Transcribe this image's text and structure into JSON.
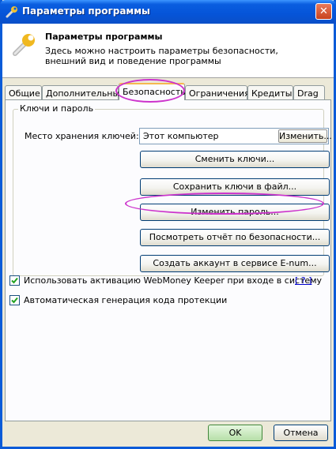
{
  "window": {
    "title": "Параметры программы",
    "close_glyph": "✕"
  },
  "header": {
    "title": "Параметры программы",
    "description": "Здесь можно настроить параметры безопасности, внешний вид и поведение программы"
  },
  "tabs": [
    {
      "label": "Общие"
    },
    {
      "label": "Дополнительные"
    },
    {
      "label": "Безопасность",
      "active": true
    },
    {
      "label": "Ограничения"
    },
    {
      "label": "Кредиты"
    },
    {
      "label": "Drag"
    }
  ],
  "security": {
    "group_title": "Ключи и пароль",
    "key_store_label": "Место хранения ключей:",
    "key_store_value": "Этот компьютер",
    "change_store_button": "Изменить...",
    "buttons": [
      "Сменить ключи...",
      "Сохранить ключи в файл...",
      "Изменить пароль...",
      "Посмотреть отчёт по безопасности...",
      "Создать аккаунт в сервисе E-num..."
    ],
    "checkbox_activation": "Использовать активацию WebMoney Keeper при входе в систему",
    "checkbox_activation_checked": true,
    "help_link": "[ ? ]",
    "checkbox_protection": "Автоматическая генерация кода протекции",
    "checkbox_protection_checked": true
  },
  "footer": {
    "ok": "OK",
    "cancel": "Отмена"
  },
  "colors": {
    "titlebar": "#0a5ee0",
    "highlight": "#cc33cc",
    "face": "#ece9d8"
  },
  "icons": {
    "title": "wrench-icon",
    "header": "wrench-icon",
    "checkmark": "checkmark-icon"
  }
}
